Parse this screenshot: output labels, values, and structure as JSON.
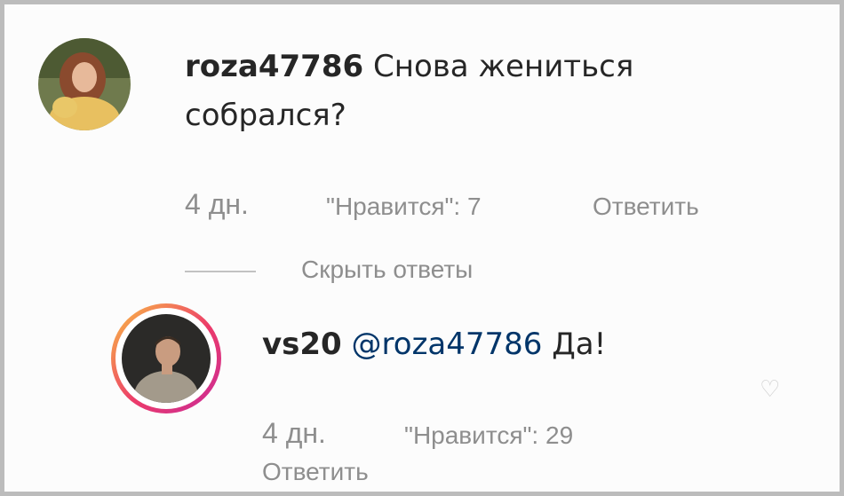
{
  "comment": {
    "username": "roza47786",
    "text_line1": "Снова жениться",
    "text_line2": "собрался?",
    "age": "4 дн.",
    "likes": "\"Нравится\": 7",
    "reply_label": "Ответить"
  },
  "hide_replies_label": "Скрыть ответы",
  "reply": {
    "username": "vs20",
    "mention": "@roza47786",
    "text": "Да!",
    "age": "4 дн.",
    "likes": "\"Нравится\": 29",
    "reply_label": "Ответить"
  }
}
